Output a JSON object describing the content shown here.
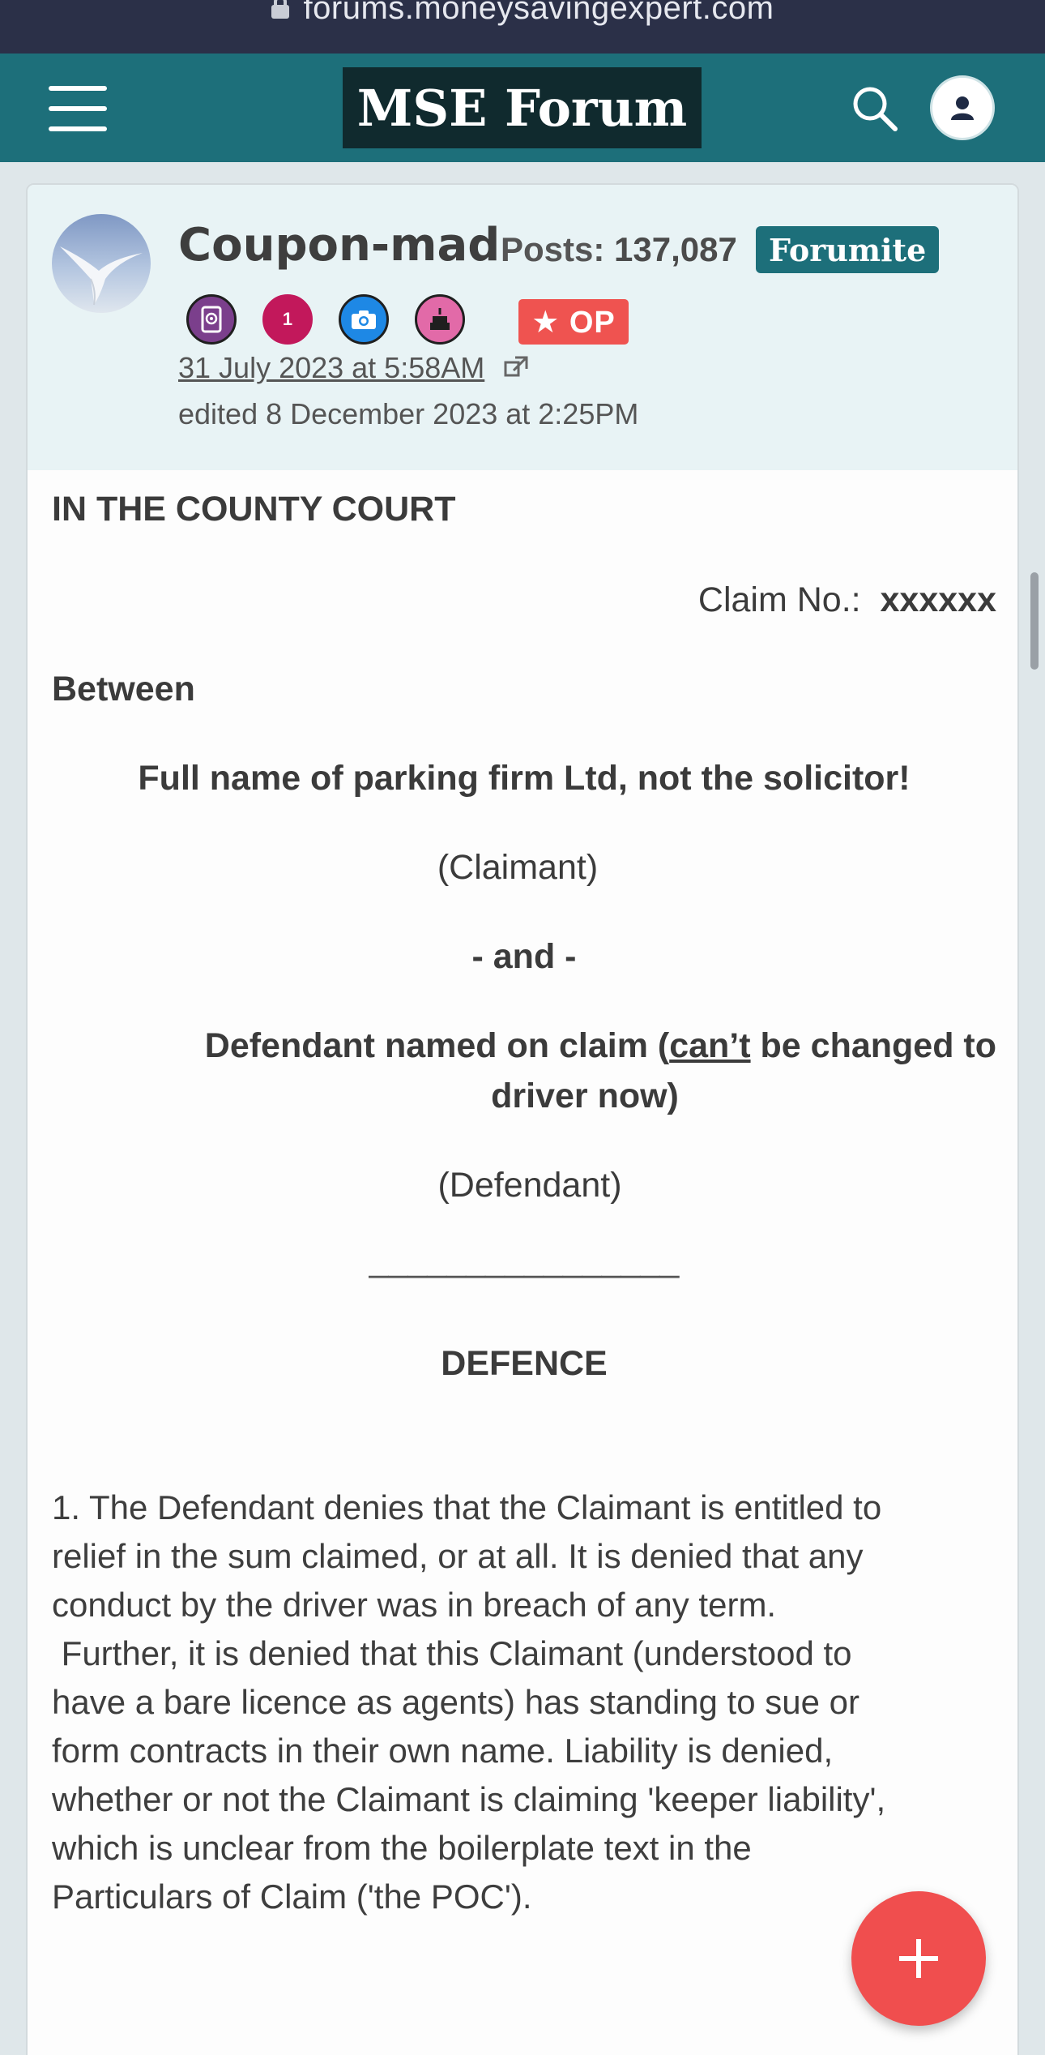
{
  "browser": {
    "url": "forums.moneysavingexpert.com"
  },
  "header": {
    "logo_text": "MSE Forum"
  },
  "post": {
    "author": {
      "name": "Coupon-mad",
      "posts_label": "Posts:",
      "posts_count": "137,087",
      "role": "Forumite",
      "badges": [
        {
          "icon": "address-book-icon",
          "color": "#7b3f8c"
        },
        {
          "icon": "first-post-1-badge",
          "text": "1",
          "color": "#c2185b"
        },
        {
          "icon": "camera-icon",
          "color": "#1e88e5"
        },
        {
          "icon": "cake-icon",
          "color": "#e26aa8"
        }
      ],
      "op_badge": "★ OP"
    },
    "date": "31 July 2023 at 5:58AM",
    "edited": "edited 8 December 2023 at 2:25PM",
    "content": {
      "court": "IN THE COUNTY COURT",
      "claim_label": "Claim No.:",
      "claim_value": "xxxxxx",
      "between": "Between",
      "claimant_name": "Full name of parking firm Ltd, not the solicitor!",
      "claimant_label": "(Claimant)",
      "and": "- and -",
      "defendant_line1_pre": "Defendant named on claim (",
      "defendant_line1_u": "can’t",
      "defendant_line1_post": " be changed to",
      "defendant_line2": "driver now)",
      "defendant_label": "(Defendant)",
      "separator": "________________",
      "defence_title": "DEFENCE",
      "para1_lines": [
        "1.  The Defendant denies that the Claimant is entitled to",
        "relief in the sum claimed, or at all.  It is denied that any",
        "conduct by the driver was in breach of any term.",
        " Further, it is denied that this Claimant (understood to",
        "have a bare licence as agents) has standing to sue or",
        "form contracts in their own name. Liability is denied,",
        "whether or not the Claimant is claiming 'keeper liability',",
        "which is unclear from the boilerplate text in the",
        "Particulars of Claim ('the POC')."
      ]
    }
  },
  "fab": {
    "icon": "plus-icon"
  }
}
